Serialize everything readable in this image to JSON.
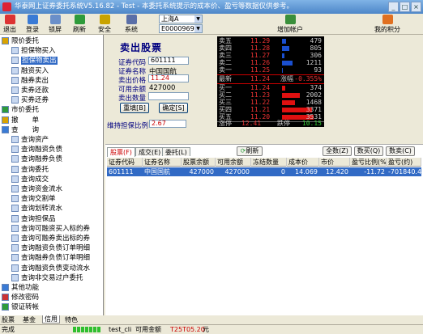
{
  "window": {
    "title": "华泰网上证券委托系统V5.16.82 - Test - 本委托系统提示的成本价、盈亏等数据仅供参考。",
    "minimize_icon": "minimize-icon",
    "maximize_icon": "maximize-icon",
    "close_icon": "close-icon"
  },
  "toolbar": {
    "buttons": [
      {
        "label": "退出",
        "icon": "exit-icon",
        "color": "#d33"
      },
      {
        "label": "登录",
        "icon": "login-icon",
        "color": "#3a7bd5"
      },
      {
        "label": "锁屏",
        "icon": "lock-icon",
        "color": "#6a8fc9"
      },
      {
        "label": "刷新",
        "icon": "refresh-icon",
        "color": "#2e9b3a"
      },
      {
        "label": "安全",
        "icon": "shield-icon",
        "color": "#c9a300"
      },
      {
        "label": "系统",
        "icon": "gear-icon",
        "color": "#5a6fa8"
      }
    ],
    "market_select": "上海A",
    "account_select": "E000096912",
    "add_account": "增加帐户",
    "points": "我的积分"
  },
  "tree": {
    "items": [
      {
        "label": "限价委托",
        "level": 0
      },
      {
        "label": "担保物买入",
        "level": 1
      },
      {
        "label": "担保物卖出",
        "level": 1,
        "selected": true
      },
      {
        "label": "融资买入",
        "level": 1
      },
      {
        "label": "融券卖出",
        "level": 1
      },
      {
        "label": "卖券还款",
        "level": 1
      },
      {
        "label": "买券还券",
        "level": 1
      },
      {
        "label": "市价委托",
        "level": 0
      },
      {
        "label": "撤　　单",
        "level": 0
      },
      {
        "label": "查　　询",
        "level": 0
      },
      {
        "label": "查询资产",
        "level": 1
      },
      {
        "label": "查询融资负债",
        "level": 1
      },
      {
        "label": "查询融券负债",
        "level": 1
      },
      {
        "label": "查询委托",
        "level": 1
      },
      {
        "label": "查询成交",
        "level": 1
      },
      {
        "label": "查询资金流水",
        "level": 1
      },
      {
        "label": "查询交割单",
        "level": 1
      },
      {
        "label": "查询划转流水",
        "level": 1
      },
      {
        "label": "查询担保品",
        "level": 1
      },
      {
        "label": "查询可融资买入标的券",
        "level": 1
      },
      {
        "label": "查询可融券卖出标的券",
        "level": 1
      },
      {
        "label": "查询融资负债订单明细",
        "level": 1
      },
      {
        "label": "查询融券负债订单明细",
        "level": 1
      },
      {
        "label": "查询融资负债变动流水",
        "level": 1
      },
      {
        "label": "查询非交易过户委托",
        "level": 1
      },
      {
        "label": "其他功能",
        "level": 0
      },
      {
        "label": "修改密码",
        "level": 0
      },
      {
        "label": "银证转帐",
        "level": 0
      }
    ],
    "tabs": [
      "股票",
      "基金",
      "信用",
      "特色"
    ],
    "active_tab": "信用"
  },
  "form": {
    "title": "卖出股票",
    "code_label": "证券代码",
    "code_value": "601111",
    "name_label": "证券名称",
    "name_value": "中国国航",
    "price_label": "卖出价格",
    "price_value": "11.24",
    "avail_label": "可用余额",
    "avail_value": "427000",
    "qty_label": "卖出数量",
    "qty_value": "",
    "reset_button": "重填[B]",
    "confirm_button": "确定[S]",
    "ratio_label": "维持担保比例",
    "ratio_value": "2.67"
  },
  "quote": {
    "sell": [
      {
        "label": "卖五",
        "price": "11.29",
        "vol": "479",
        "bar": 0.13
      },
      {
        "label": "卖四",
        "price": "11.28",
        "vol": "805",
        "bar": 0.22
      },
      {
        "label": "卖三",
        "price": "11.27",
        "vol": "306",
        "bar": 0.08
      },
      {
        "label": "卖二",
        "price": "11.26",
        "vol": "1211",
        "bar": 0.33
      },
      {
        "label": "卖一",
        "price": "11.25",
        "vol": "93",
        "bar": 0.03
      }
    ],
    "latest_label": "最新",
    "latest_price": "11.24",
    "change_label": "涨幅",
    "change_value": "-0.355%",
    "buy": [
      {
        "label": "买一",
        "price": "11.24",
        "vol": "374",
        "bar": 0.1
      },
      {
        "label": "买二",
        "price": "11.23",
        "vol": "2002",
        "bar": 0.55
      },
      {
        "label": "买三",
        "price": "11.22",
        "vol": "1468",
        "bar": 0.4
      },
      {
        "label": "买四",
        "price": "11.21",
        "vol": "3371",
        "bar": 0.93
      },
      {
        "label": "买五",
        "price": "11.20",
        "vol": "3531",
        "bar": 0.97
      }
    ],
    "limit_up_label": "涨停",
    "limit_up": "12.41",
    "limit_down_label": "跌停",
    "limit_down": "10.15"
  },
  "grid": {
    "tabs": [
      "股票(F)",
      "成交(E)",
      "委托(L)"
    ],
    "refresh": "刷新",
    "select_all": "全数(Z)",
    "half": "数买(Q)",
    "third": "数卖(C)",
    "headers": [
      "证券代码",
      "证券名称",
      "股票余额",
      "可用余额",
      "冻结数量",
      "成本价",
      "市价",
      "盈亏比例(%)",
      "盈亏(约)"
    ],
    "rows": [
      [
        "601111",
        "中国国航",
        "427000",
        "427000",
        "0",
        "14.069",
        "12.420",
        "-11.72",
        "-701840.4"
      ]
    ]
  },
  "statusbar": {
    "left": "完成",
    "file": "test_cli",
    "funds_label": "可用金额",
    "funds_value": "T25T05.20",
    "unit": "元"
  }
}
